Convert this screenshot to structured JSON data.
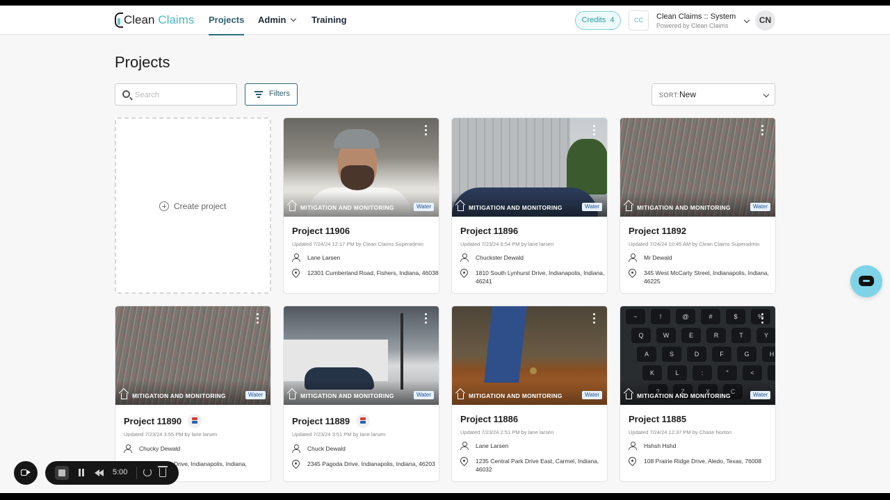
{
  "nav": {
    "logo_a": "Clean",
    "logo_b": "Claims",
    "items": [
      {
        "label": "Projects",
        "active": true
      },
      {
        "label": "Admin",
        "has_dropdown": true
      },
      {
        "label": "Training"
      }
    ],
    "credits_label": "Credits",
    "credits_count": "4",
    "org_logo_text": "CC",
    "org_name": "Clean Claims :: System",
    "org_sub": "Powered by Clean Claims",
    "avatar": "CN"
  },
  "page": {
    "title": "Projects",
    "search_placeholder": "Search",
    "filters_label": "Filters",
    "sort_label": "SORT:",
    "sort_value": "New",
    "create_label": "Create project"
  },
  "projects": [
    {
      "title": "Project 11906",
      "type": "MITIGATION AND MONITORING",
      "badge": "Water",
      "flag": false,
      "updated": "Updated 7/24/24 12:17 PM by Clean Claims Superadmin",
      "person": "Lane Larsen",
      "address": "12301 Cumberland Road, Fishers, Indiana, 46038",
      "photo": "person-on-video-call"
    },
    {
      "title": "Project 11896",
      "type": "MITIGATION AND MONITORING",
      "badge": "Water",
      "flag": false,
      "updated": "Updated 7/23/24 6:54 PM by lane larsen",
      "person": "Chuckster Dewald",
      "address": "1810 South Lynhurst Drive, Indianapolis, Indiana, 46241",
      "photo": "building-and-car"
    },
    {
      "title": "Project 11892",
      "type": "MITIGATION AND MONITORING",
      "badge": "Water",
      "flag": false,
      "updated": "Updated 7/24/24 10:45 AM by Clean Claims Superadmin",
      "person": "Mr Dewald",
      "address": "345 West McCarty Street, Indianapolis, Indiana, 46225",
      "photo": "carpet"
    },
    {
      "title": "Project 11890",
      "type": "MITIGATION AND MONITORING",
      "badge": "Water",
      "flag": true,
      "updated": "Updated 7/23/24 3:55 PM by lane larsen",
      "person": "Chucky Dewald",
      "address": "Drive, Indianapolis, Indiana,",
      "photo": "carpet"
    },
    {
      "title": "Project 11889",
      "type": "MITIGATION AND MONITORING",
      "badge": "Water",
      "flag": true,
      "updated": "Updated 7/23/24 3:51 PM by lane larsen",
      "person": "Chuck Dewald",
      "address": "2345 Pagoda Drive, Indianapolis, Indiana, 46203",
      "photo": "parking-lot"
    },
    {
      "title": "Project 11886",
      "type": "MITIGATION AND MONITORING",
      "badge": "Water",
      "flag": false,
      "updated": "Updated 7/23/24 2:51 PM by lane larsen",
      "person": "Lane Larsen",
      "address": "1235 Central Park Drive East, Carmel, Indiana, 46032",
      "photo": "desk"
    },
    {
      "title": "Project 11885",
      "type": "MITIGATION AND MONITORING",
      "badge": "Water",
      "flag": false,
      "updated": "Updated 7/24/24 12:37 PM by Chase Norton",
      "person": "Hshsh Hshd",
      "address": "108 Prairie Ridge Drive, Aledo, Texas, 76008",
      "photo": "keyboard"
    }
  ],
  "keyboard_keys": [
    "~",
    "!",
    "@",
    "#",
    "$",
    "%",
    "Q",
    "W",
    "E",
    "R",
    "T",
    "Y",
    "A",
    "S",
    "D",
    "F",
    "G",
    "H",
    "K",
    "L",
    ":",
    "\"",
    "<",
    ">",
    "?",
    "Z",
    "X",
    "C"
  ],
  "recorder": {
    "time": "5:00"
  },
  "colors": {
    "accent": "#2e6b7a",
    "brand_teal": "#4fb8c2",
    "badge_bg": "#e8f2ff",
    "chat_bubble": "#7ed4e6"
  }
}
